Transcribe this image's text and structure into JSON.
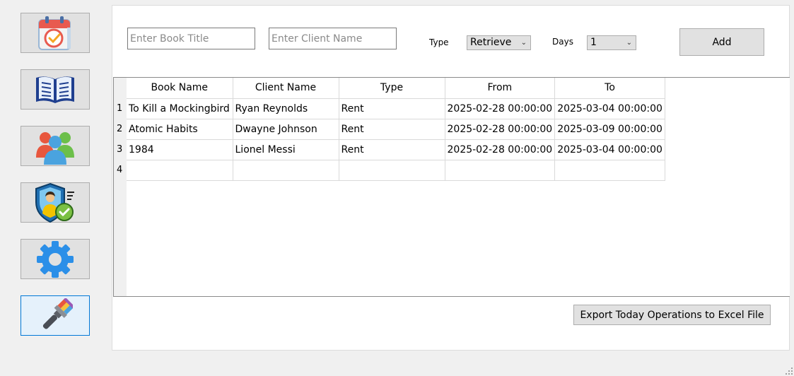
{
  "sidebar": {
    "items": [
      {
        "name": "calendar"
      },
      {
        "name": "books"
      },
      {
        "name": "clients"
      },
      {
        "name": "employees"
      },
      {
        "name": "settings"
      },
      {
        "name": "theme"
      }
    ]
  },
  "form": {
    "book_title_placeholder": "Enter Book Title",
    "book_title_value": "",
    "client_name_placeholder": "Enter Client Name",
    "client_name_value": "",
    "type_label": "Type",
    "type_value": "Retrieve",
    "days_label": "Days",
    "days_value": "1",
    "add_label": "Add"
  },
  "table": {
    "columns": [
      "Book Name",
      "Client Name",
      "Type",
      "From",
      "To"
    ],
    "rows": [
      {
        "num": "1",
        "cells": [
          "To Kill a Mockingbird",
          "Ryan Reynolds",
          "Rent",
          "2025-02-28 00:00:00",
          "2025-03-04 00:00:00"
        ]
      },
      {
        "num": "2",
        "cells": [
          "Atomic Habits",
          "Dwayne Johnson",
          "Rent",
          "2025-02-28 00:00:00",
          "2025-03-09 00:00:00"
        ]
      },
      {
        "num": "3",
        "cells": [
          "1984",
          "Lionel Messi",
          "Rent",
          "2025-02-28 00:00:00",
          "2025-03-04 00:00:00"
        ]
      },
      {
        "num": "4",
        "cells": [
          "",
          "",
          "",
          "",
          ""
        ]
      }
    ]
  },
  "export_label": "Export Today Operations to Excel File",
  "colors": {
    "active_border": "#0078d7",
    "button_bg": "#e1e1e1"
  }
}
